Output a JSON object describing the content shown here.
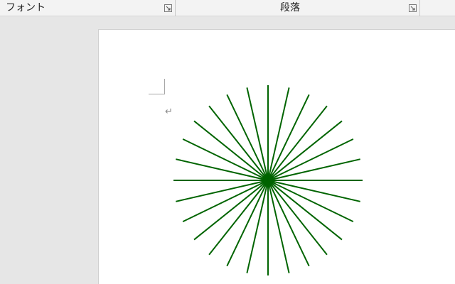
{
  "ribbon": {
    "groups": [
      {
        "label": "フォント",
        "launcher_icon": "dialog-launcher-icon"
      },
      {
        "label": "段落",
        "launcher_icon": "dialog-launcher-icon"
      }
    ]
  },
  "document": {
    "paragraph_mark": "↵",
    "shape": {
      "type": "starburst-lines",
      "ray_count": 28,
      "stroke_color": "#006400"
    }
  }
}
